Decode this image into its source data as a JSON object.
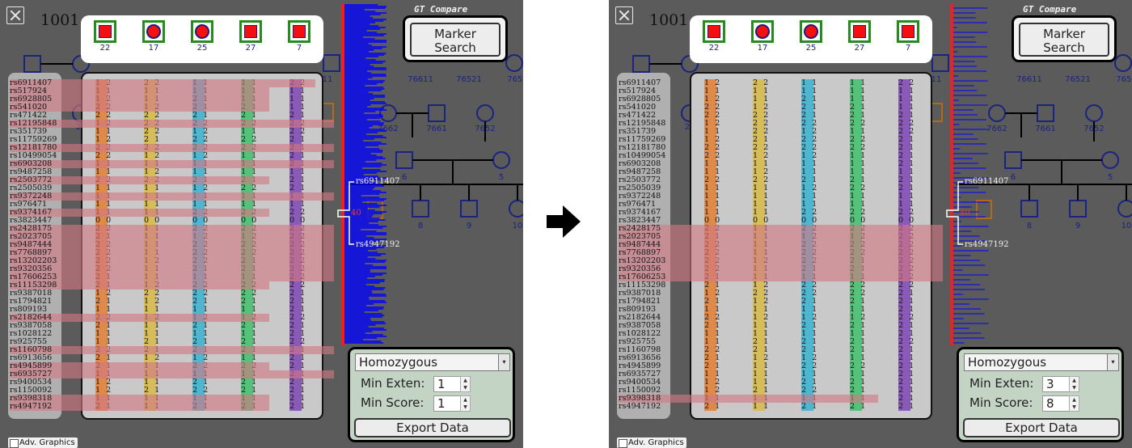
{
  "family_id": "1001",
  "title_label": "GT Compare",
  "marker_search_label": "Marker Search",
  "affected_ids": [
    "22",
    "17",
    "25",
    "27",
    "7"
  ],
  "pedigree_labels_visible": [
    "76611",
    "76521",
    "7652",
    "7662",
    "7661",
    "7652",
    "6",
    "5",
    "8",
    "9",
    "10",
    "11",
    "2"
  ],
  "rs_ids": [
    "rs6911407",
    "rs517924",
    "rs6928805",
    "rs541020",
    "rs471422",
    "rs12195848",
    "rs351739",
    "rs11759269",
    "rs12181780",
    "rs10499054",
    "rs6903208",
    "rs9487258",
    "rs2503772",
    "rs2505039",
    "rs9372248",
    "rs976471",
    "rs9374167",
    "rs3823447",
    "rs2428175",
    "rs2023705",
    "rs9487444",
    "rs7768897",
    "rs13202203",
    "rs9320356",
    "rs17606253",
    "rs11153298",
    "rs9387018",
    "rs1794821",
    "rs809193",
    "rs2182644",
    "rs9387058",
    "rs1028122",
    "rs925755",
    "rs1160798",
    "rs6913656",
    "rs4945899",
    "rs6935727",
    "rs9400534",
    "rs1150092",
    "rs9398318",
    "rs4947192"
  ],
  "genotype_columns": [
    {
      "color": "#e08a4a",
      "rows": [
        "1 2",
        "1 1",
        "1 2",
        "2 2",
        "2 2",
        "1 2",
        "1 1",
        "1 2",
        "2 2",
        "2 2",
        "1 1",
        "1 1",
        "2 2",
        "1 1",
        "1 1",
        "1 1",
        "1 1",
        "0 0",
        "2 2",
        "2 1",
        "2 2",
        "2 2",
        "2 2",
        "2 2",
        "2 1",
        "2 1",
        "1 2",
        "2 1",
        "1 1",
        "2 2",
        "2 1",
        "1 1",
        "1 1",
        "2 2",
        "2 1",
        "2 1",
        "1 1",
        "1 2",
        "1 2",
        "1 1",
        "2 1"
      ]
    },
    {
      "color": "#d6bd5a",
      "rows": [
        "2 2",
        "1 1",
        "1 1",
        "1 2",
        "2 2",
        "2 2",
        "2 2",
        "2 1",
        "2 2",
        "1 2",
        "1 1",
        "1 2",
        "2 2",
        "1 1",
        "1 1",
        "1 1",
        "1 1",
        "0 0",
        "1 1",
        "1 1",
        "1 1",
        "1 1",
        "1 2",
        "1 1",
        "1 1",
        "1 2",
        "2 2",
        "1 2",
        "1 1",
        "1 2",
        "1 1",
        "1 1",
        "2 1",
        "2 1",
        "1 2",
        "1 1",
        "1 1",
        "1 1",
        "2 1",
        "1 1",
        "1 1"
      ]
    },
    {
      "color": "#4fb6d0",
      "rows": [
        "1 1",
        "1 1",
        "2 1",
        "2 1",
        "2 1",
        "2 2",
        "1 2",
        "2 2",
        "2 2",
        "1 2",
        "1 1",
        "1 1",
        "2 1",
        "1 2",
        "1 1",
        "1 1",
        "2 2",
        "0 0",
        "2 2",
        "1 2",
        "2 2",
        "2 2",
        "2 2",
        "2 1",
        "1 1",
        "2 2",
        "2 2",
        "2 1",
        "1 1",
        "1 2",
        "2 1",
        "1 1",
        "2 1",
        "2 1",
        "1 2",
        "2 2",
        "1 1",
        "2 1",
        "2 2",
        "1 1",
        "2 1"
      ]
    },
    {
      "color": "#54c27a",
      "rows": [
        "1 1",
        "1 1",
        "1 1",
        "2 1",
        "2 1",
        "2 2",
        "1 1",
        "2 2",
        "2 2",
        "1 1",
        "1 1",
        "1 1",
        "2 1",
        "2 2",
        "1 1",
        "1 1",
        "2 2",
        "0 0",
        "2 2",
        "1 2",
        "2 2",
        "2 2",
        "2 1",
        "2 1",
        "1 1",
        "2 2",
        "2 2",
        "2 1",
        "1 1",
        "1 2",
        "2 1",
        "1 1",
        "2 1",
        "2 1",
        "1 1",
        "2 2",
        "1 1",
        "2 1",
        "2 1",
        "1 1",
        "2 1"
      ]
    },
    {
      "color": "#8a5ab8",
      "rows": [
        "2 2",
        "1 1",
        "1 1",
        "1 1",
        "2 1",
        "2 2",
        "2 2",
        "2 1",
        "2 1",
        "2 1",
        "2 1",
        "1 1",
        "2 1",
        "2 1",
        "1 1",
        "1 1",
        "2 2",
        "0 0",
        "2 2",
        "2 2",
        "2 2",
        "2 2",
        "2 2",
        "2 2",
        "2 2",
        "2 2",
        "2 1",
        "2 1",
        "2 1",
        "2 2",
        "2 1",
        "2 1",
        "2 2",
        "2 1",
        "2 1",
        "2 1",
        "2 1",
        "2 1",
        "2 1",
        "2 1",
        "2 1"
      ]
    }
  ],
  "flank_top_marker": "rs6911407",
  "flank_bottom_marker": "rs4947192",
  "left": {
    "score_value": "40",
    "mode": "Homozygous",
    "min_exten_label": "Min Exten:",
    "min_exten_value": "1",
    "min_score_label": "Min Score:",
    "min_score_value": "1",
    "export_label": "Export Data",
    "adv_label": "Adv. Graphics",
    "highlight_rows": [
      0,
      1,
      2,
      3,
      5,
      8,
      10,
      12,
      14,
      16,
      18,
      19,
      20,
      21,
      22,
      23,
      24,
      25,
      29,
      33,
      35,
      36,
      39,
      40
    ]
  },
  "right": {
    "score_value": "40",
    "mode": "Homozygous",
    "min_exten_label": "Min Exten:",
    "min_exten_value": "3",
    "min_score_label": "Min Score:",
    "min_score_value": "8",
    "export_label": "Export Data",
    "adv_label": "Adv. Graphics",
    "highlight_rows": [
      18,
      19,
      20,
      21,
      22,
      23,
      24,
      39
    ]
  },
  "colors": {
    "background": "#5b5b5b",
    "score_line": "#0000ff",
    "marker_bar": "#f02020",
    "highlight": "#d2787e",
    "pedigree": "#1a237e"
  }
}
